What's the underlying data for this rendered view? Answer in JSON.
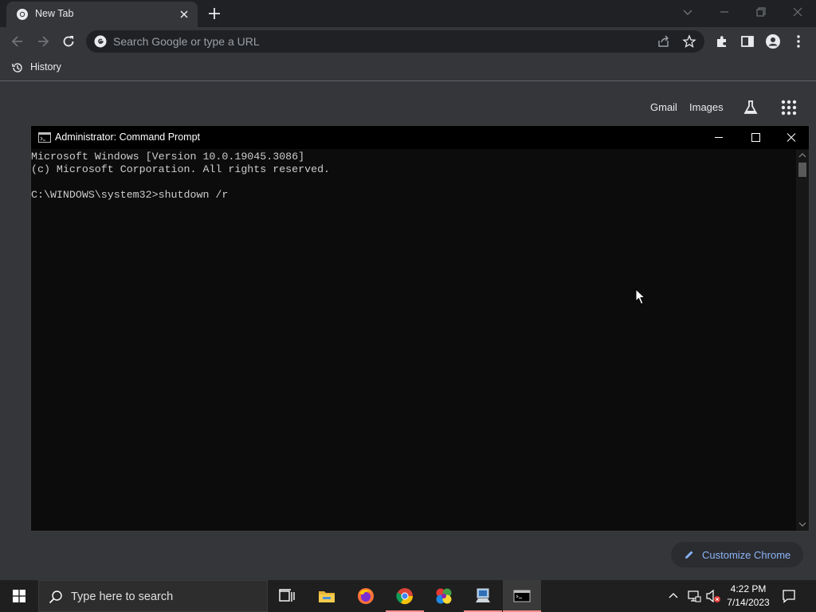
{
  "browser": {
    "tab_title": "New Tab",
    "omnibox_placeholder": "Search Google or type a URL",
    "bookmark_history": "History"
  },
  "ntp": {
    "gmail": "Gmail",
    "images": "Images",
    "customize": "Customize Chrome"
  },
  "cmd": {
    "title": "Administrator: Command Prompt",
    "lines": [
      "Microsoft Windows [Version 10.0.19045.3086]",
      "(c) Microsoft Corporation. All rights reserved.",
      "",
      "C:\\WINDOWS\\system32>shutdown /r"
    ]
  },
  "taskbar": {
    "search_placeholder": "Type here to search",
    "time": "4:22 PM",
    "date": "7/14/2023",
    "apps": [
      "task-view",
      "file-explorer",
      "firefox",
      "chrome",
      "color-app",
      "network-app",
      "command-prompt"
    ]
  },
  "colors": {
    "chrome_dark": "#35363a",
    "tabstrip": "#202124",
    "link_blue": "#8ab4f8",
    "console_bg": "#0c0c0c",
    "taskbar_bg": "#1f1f1f"
  }
}
